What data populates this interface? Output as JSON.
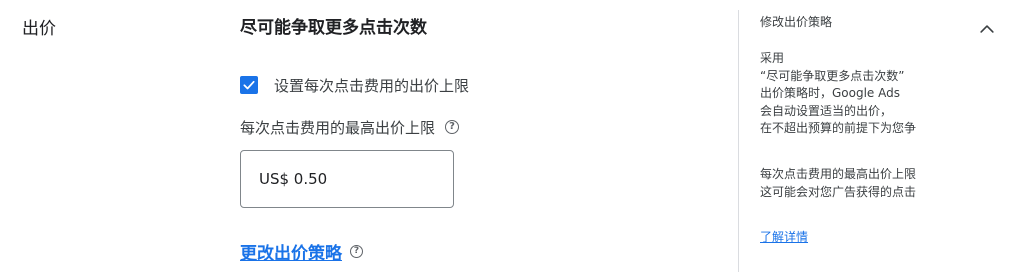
{
  "section": {
    "title": "出价"
  },
  "strategy": {
    "heading": "尽可能争取更多点击次数",
    "checkbox_label": "设置每次点击费用的出价上限",
    "checkbox_checked": true,
    "field_label": "每次点击费用的最高出价上限",
    "field_value": "US$ 0.50",
    "change_link": "更改出价策略"
  },
  "side_panel": {
    "title": "修改出价策略",
    "paragraph1": "采用\n“尽可能争取更多点击次数”\n出价策略时，Google Ads\n会自动设置适当的出价，\n在不超出预算的前提下为您争",
    "paragraph2": "每次点击费用的最高出价上限\n这可能会对您广告获得的点击",
    "learn_more": "了解详情"
  },
  "icons": {
    "help": "help-circle-icon",
    "check": "check-icon",
    "collapse": "chevron-up-icon"
  },
  "colors": {
    "accent": "#1a73e8",
    "text": "#202124",
    "divider": "#dadce0"
  }
}
